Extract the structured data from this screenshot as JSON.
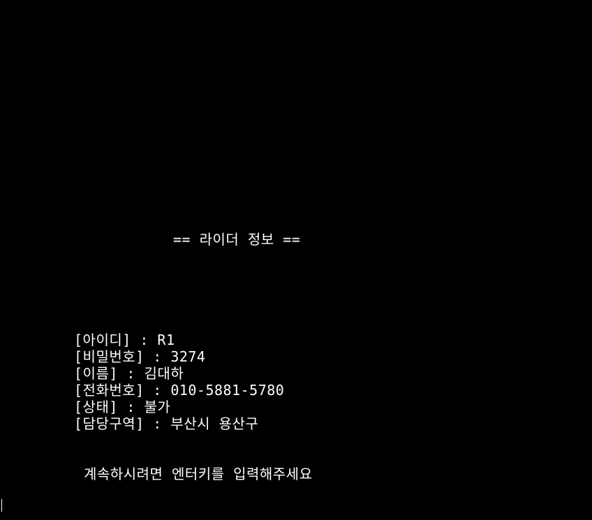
{
  "console": {
    "title": "== 라이더 정보 ==",
    "fields": [
      {
        "label": "[아이디]",
        "sep": " : ",
        "value": "R1"
      },
      {
        "label": "[비밀번호]",
        "sep": " : ",
        "value": "3274"
      },
      {
        "label": "[이름]",
        "sep": " : ",
        "value": "김대하"
      },
      {
        "label": "[전화번호]",
        "sep": " : ",
        "value": "010-5881-5780"
      },
      {
        "label": "[상태]",
        "sep": " : ",
        "value": "불가"
      },
      {
        "label": "[담당구역]",
        "sep": " : ",
        "value": "부산시 용산구"
      }
    ],
    "prompt": "계속하시려면 엔터키를 입력해주세요"
  },
  "colors": {
    "background": "#000000",
    "text": "#ffffff"
  }
}
